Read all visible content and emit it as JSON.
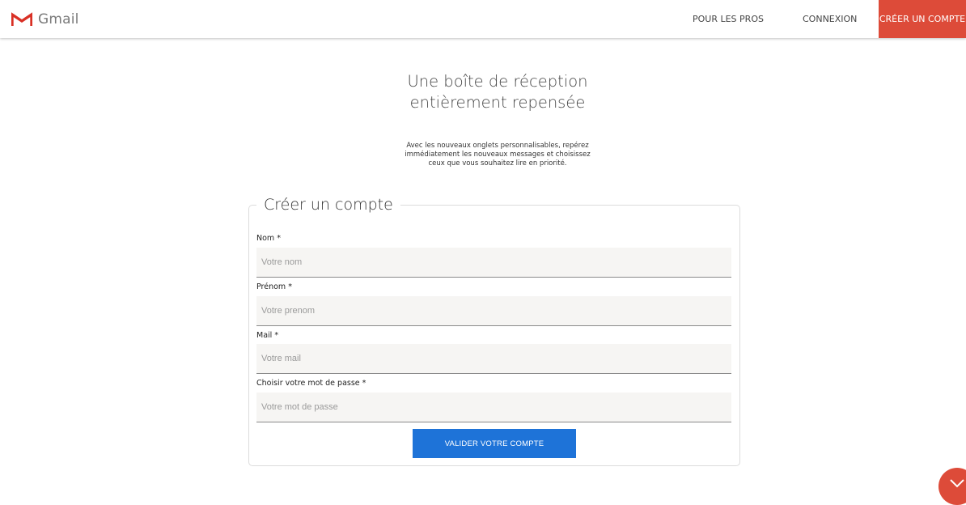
{
  "header": {
    "brand": "Gmail",
    "nav": {
      "pros": "POUR LES PROS",
      "login": "CONNEXION",
      "create": "CRÉER UN COMPTE"
    },
    "accent_color": "#dd4b39"
  },
  "hero": {
    "title_line1": "Une boîte de réception",
    "title_line2": "entièrement repensée",
    "desc_line1": "Avec les nouveaux onglets personnalisables, repérez",
    "desc_line2": "immédiatement les nouveaux messages et choisissez",
    "desc_line3": "ceux que vous souhaitez lire en priorité."
  },
  "form": {
    "title": "Créer un compte",
    "fields": [
      {
        "label": "Nom *",
        "placeholder": "Votre nom",
        "value": ""
      },
      {
        "label": "Prénom *",
        "placeholder": "Votre prenom",
        "value": ""
      },
      {
        "label": "Mail *",
        "placeholder": "Votre mail",
        "value": ""
      },
      {
        "label": "Choisir votre mot de passe *",
        "placeholder": "Votre mot de passe",
        "value": ""
      }
    ],
    "submit_label": "VALIDER VOTRE COMPTE",
    "submit_color": "#1e73d8"
  },
  "icons": {
    "logo": "gmail-m-logo-icon",
    "scroll": "chevron-down-icon"
  }
}
